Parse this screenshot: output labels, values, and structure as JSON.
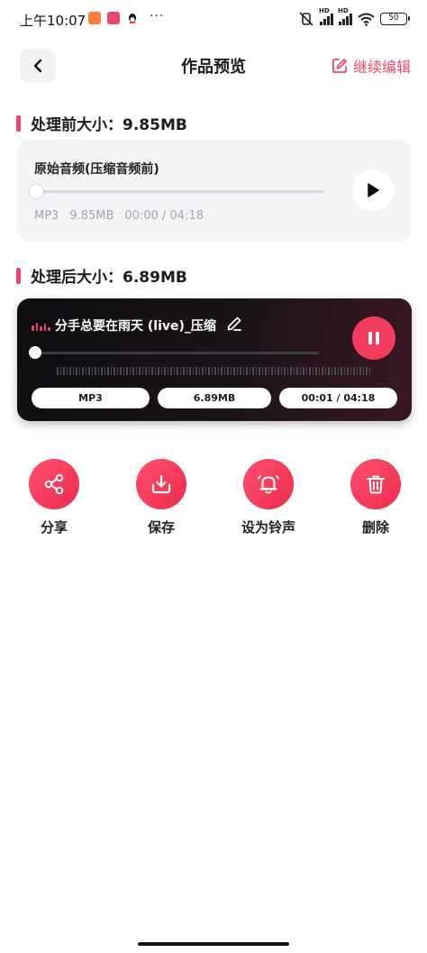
{
  "status_bar": {
    "time": "上午10:07",
    "more": "···",
    "battery": "50",
    "signal_tags": [
      "HD",
      "HD"
    ]
  },
  "header": {
    "title": "作品预览",
    "continue_edit": "继续编辑",
    "accent_color": "#f0426a"
  },
  "original": {
    "heading": "处理前大小：9.85MB",
    "name": "原始音频(压缩音频前)",
    "format": "MP3",
    "size": "9.85MB",
    "time": "00:00 / 04:18",
    "progress": 0.0,
    "state": "paused",
    "icon": "play-icon"
  },
  "processed": {
    "heading": "处理后大小：6.89MB",
    "name": "分手总要在雨天 (live)_压缩",
    "format": "MP3",
    "size": "6.89MB",
    "time": "00:01 / 04:18",
    "progress": 0.004,
    "state": "playing",
    "icon": "pause-icon"
  },
  "actions": [
    {
      "label": "分享",
      "icon": "share-icon"
    },
    {
      "label": "保存",
      "icon": "download-icon"
    },
    {
      "label": "设为铃声",
      "icon": "bell-icon"
    },
    {
      "label": "删除",
      "icon": "trash-icon"
    }
  ],
  "colors": {
    "accent": "#f0426a",
    "action_button": "#f23c5e",
    "dark_card": "#151215"
  }
}
